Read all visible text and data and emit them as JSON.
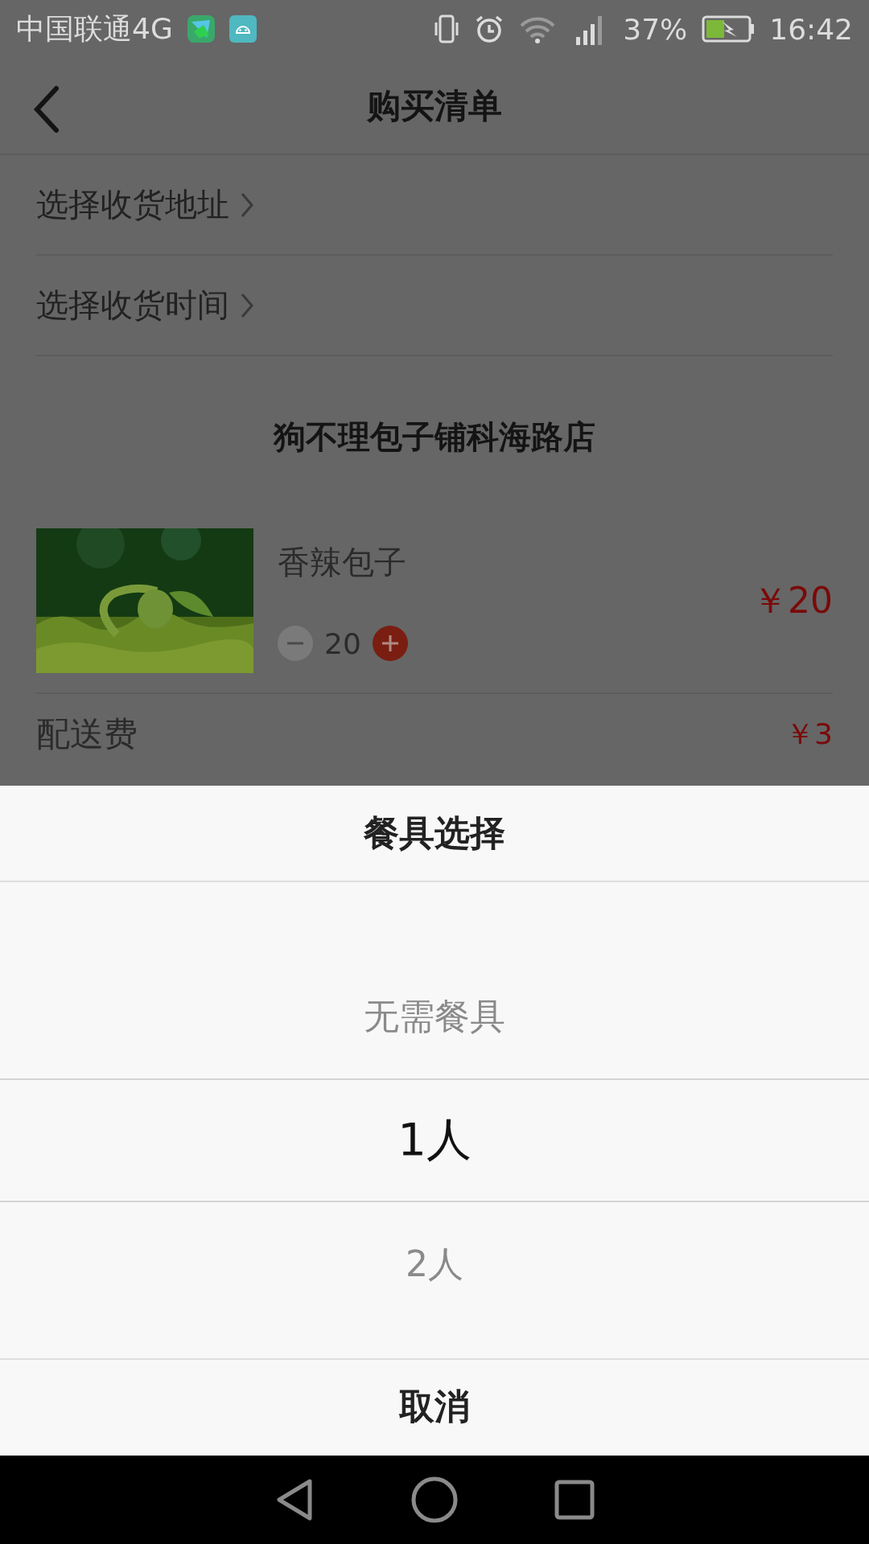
{
  "status_bar": {
    "carrier": "中国联通4G",
    "battery": "37%",
    "time": "16:42"
  },
  "header": {
    "title": "购买清单"
  },
  "selectors": [
    {
      "label": "选择收货地址"
    },
    {
      "label": "选择收货时间"
    }
  ],
  "shop": {
    "name": "狗不理包子铺科海路店"
  },
  "items": [
    {
      "name": "香辣包子",
      "quantity": "20",
      "price": "￥20"
    }
  ],
  "delivery_fee": {
    "label": "配送费",
    "amount": "￥3"
  },
  "sheet": {
    "title": "餐具选择",
    "options": [
      {
        "label": "无需餐具",
        "selected": false
      },
      {
        "label": "1人",
        "selected": true
      },
      {
        "label": "2人",
        "selected": false
      }
    ],
    "cancel": "取消"
  }
}
